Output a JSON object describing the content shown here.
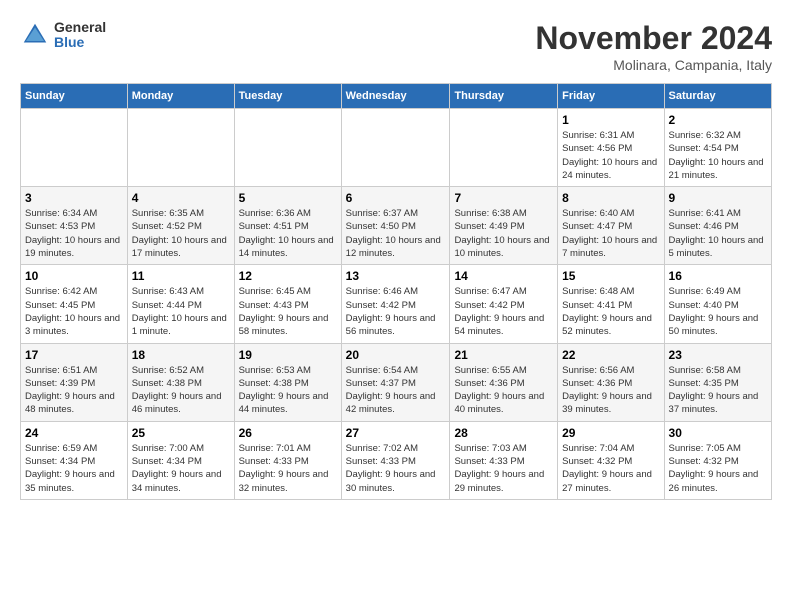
{
  "logo": {
    "general": "General",
    "blue": "Blue"
  },
  "title": "November 2024",
  "location": "Molinara, Campania, Italy",
  "weekdays": [
    "Sunday",
    "Monday",
    "Tuesday",
    "Wednesday",
    "Thursday",
    "Friday",
    "Saturday"
  ],
  "weeks": [
    [
      {
        "day": "",
        "info": ""
      },
      {
        "day": "",
        "info": ""
      },
      {
        "day": "",
        "info": ""
      },
      {
        "day": "",
        "info": ""
      },
      {
        "day": "",
        "info": ""
      },
      {
        "day": "1",
        "info": "Sunrise: 6:31 AM\nSunset: 4:56 PM\nDaylight: 10 hours and 24 minutes."
      },
      {
        "day": "2",
        "info": "Sunrise: 6:32 AM\nSunset: 4:54 PM\nDaylight: 10 hours and 21 minutes."
      }
    ],
    [
      {
        "day": "3",
        "info": "Sunrise: 6:34 AM\nSunset: 4:53 PM\nDaylight: 10 hours and 19 minutes."
      },
      {
        "day": "4",
        "info": "Sunrise: 6:35 AM\nSunset: 4:52 PM\nDaylight: 10 hours and 17 minutes."
      },
      {
        "day": "5",
        "info": "Sunrise: 6:36 AM\nSunset: 4:51 PM\nDaylight: 10 hours and 14 minutes."
      },
      {
        "day": "6",
        "info": "Sunrise: 6:37 AM\nSunset: 4:50 PM\nDaylight: 10 hours and 12 minutes."
      },
      {
        "day": "7",
        "info": "Sunrise: 6:38 AM\nSunset: 4:49 PM\nDaylight: 10 hours and 10 minutes."
      },
      {
        "day": "8",
        "info": "Sunrise: 6:40 AM\nSunset: 4:47 PM\nDaylight: 10 hours and 7 minutes."
      },
      {
        "day": "9",
        "info": "Sunrise: 6:41 AM\nSunset: 4:46 PM\nDaylight: 10 hours and 5 minutes."
      }
    ],
    [
      {
        "day": "10",
        "info": "Sunrise: 6:42 AM\nSunset: 4:45 PM\nDaylight: 10 hours and 3 minutes."
      },
      {
        "day": "11",
        "info": "Sunrise: 6:43 AM\nSunset: 4:44 PM\nDaylight: 10 hours and 1 minute."
      },
      {
        "day": "12",
        "info": "Sunrise: 6:45 AM\nSunset: 4:43 PM\nDaylight: 9 hours and 58 minutes."
      },
      {
        "day": "13",
        "info": "Sunrise: 6:46 AM\nSunset: 4:42 PM\nDaylight: 9 hours and 56 minutes."
      },
      {
        "day": "14",
        "info": "Sunrise: 6:47 AM\nSunset: 4:42 PM\nDaylight: 9 hours and 54 minutes."
      },
      {
        "day": "15",
        "info": "Sunrise: 6:48 AM\nSunset: 4:41 PM\nDaylight: 9 hours and 52 minutes."
      },
      {
        "day": "16",
        "info": "Sunrise: 6:49 AM\nSunset: 4:40 PM\nDaylight: 9 hours and 50 minutes."
      }
    ],
    [
      {
        "day": "17",
        "info": "Sunrise: 6:51 AM\nSunset: 4:39 PM\nDaylight: 9 hours and 48 minutes."
      },
      {
        "day": "18",
        "info": "Sunrise: 6:52 AM\nSunset: 4:38 PM\nDaylight: 9 hours and 46 minutes."
      },
      {
        "day": "19",
        "info": "Sunrise: 6:53 AM\nSunset: 4:38 PM\nDaylight: 9 hours and 44 minutes."
      },
      {
        "day": "20",
        "info": "Sunrise: 6:54 AM\nSunset: 4:37 PM\nDaylight: 9 hours and 42 minutes."
      },
      {
        "day": "21",
        "info": "Sunrise: 6:55 AM\nSunset: 4:36 PM\nDaylight: 9 hours and 40 minutes."
      },
      {
        "day": "22",
        "info": "Sunrise: 6:56 AM\nSunset: 4:36 PM\nDaylight: 9 hours and 39 minutes."
      },
      {
        "day": "23",
        "info": "Sunrise: 6:58 AM\nSunset: 4:35 PM\nDaylight: 9 hours and 37 minutes."
      }
    ],
    [
      {
        "day": "24",
        "info": "Sunrise: 6:59 AM\nSunset: 4:34 PM\nDaylight: 9 hours and 35 minutes."
      },
      {
        "day": "25",
        "info": "Sunrise: 7:00 AM\nSunset: 4:34 PM\nDaylight: 9 hours and 34 minutes."
      },
      {
        "day": "26",
        "info": "Sunrise: 7:01 AM\nSunset: 4:33 PM\nDaylight: 9 hours and 32 minutes."
      },
      {
        "day": "27",
        "info": "Sunrise: 7:02 AM\nSunset: 4:33 PM\nDaylight: 9 hours and 30 minutes."
      },
      {
        "day": "28",
        "info": "Sunrise: 7:03 AM\nSunset: 4:33 PM\nDaylight: 9 hours and 29 minutes."
      },
      {
        "day": "29",
        "info": "Sunrise: 7:04 AM\nSunset: 4:32 PM\nDaylight: 9 hours and 27 minutes."
      },
      {
        "day": "30",
        "info": "Sunrise: 7:05 AM\nSunset: 4:32 PM\nDaylight: 9 hours and 26 minutes."
      }
    ]
  ]
}
